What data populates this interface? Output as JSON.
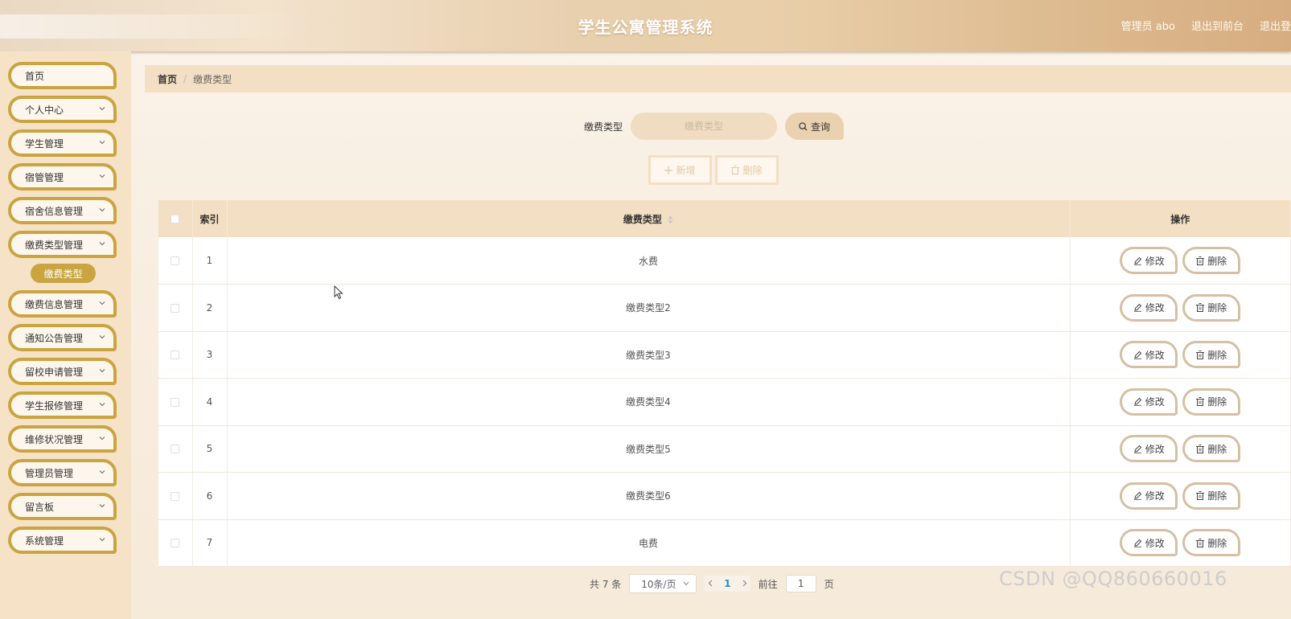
{
  "header": {
    "title": "学生公寓管理系统",
    "user_label": "管理员 abo",
    "to_front_label": "退出到前台",
    "logout_label": "退出登"
  },
  "sidebar": {
    "items": [
      {
        "label": "首页",
        "has_chevron": false
      },
      {
        "label": "个人中心",
        "has_chevron": true
      },
      {
        "label": "学生管理",
        "has_chevron": true
      },
      {
        "label": "宿管管理",
        "has_chevron": true
      },
      {
        "label": "宿舍信息管理",
        "has_chevron": true
      },
      {
        "label": "缴费类型管理",
        "has_chevron": true,
        "expanded": true
      },
      {
        "label": "缴费信息管理",
        "has_chevron": true
      },
      {
        "label": "通知公告管理",
        "has_chevron": true
      },
      {
        "label": "留校申请管理",
        "has_chevron": true
      },
      {
        "label": "学生报修管理",
        "has_chevron": true
      },
      {
        "label": "维修状况管理",
        "has_chevron": true
      },
      {
        "label": "管理员管理",
        "has_chevron": true
      },
      {
        "label": "留言板",
        "has_chevron": true
      },
      {
        "label": "系统管理",
        "has_chevron": true
      }
    ],
    "active_sub_item": "缴费类型"
  },
  "breadcrumb": {
    "home": "首页",
    "separator": "/",
    "current": "缴费类型"
  },
  "search": {
    "label": "缴费类型",
    "placeholder": "缴费类型",
    "query_label": "查询"
  },
  "actions": {
    "add_label": "新增",
    "delete_label": "删除"
  },
  "table": {
    "columns": {
      "index": "索引",
      "type": "缴费类型",
      "ops": "操作"
    },
    "edit_label": "修改",
    "delete_label": "删除",
    "rows": [
      {
        "index": "1",
        "type": "水费"
      },
      {
        "index": "2",
        "type": "缴费类型2"
      },
      {
        "index": "3",
        "type": "缴费类型3"
      },
      {
        "index": "4",
        "type": "缴费类型4"
      },
      {
        "index": "5",
        "type": "缴费类型5"
      },
      {
        "index": "6",
        "type": "缴费类型6"
      },
      {
        "index": "7",
        "type": "电费"
      }
    ]
  },
  "pagination": {
    "total_text": "共 7 条",
    "page_size": "10条/页",
    "current_page": "1",
    "goto_prefix": "前往",
    "goto_value": "1",
    "goto_suffix": "页"
  },
  "watermark": "CSDN @QQ860660016",
  "colors": {
    "accent_gold": "#c9a441",
    "header_tan": "#e8cfae",
    "table_header": "#f3dfc3",
    "page_number": "#1e90d8"
  },
  "icons": [
    "chevron-down-icon",
    "search-icon",
    "plus-icon",
    "trash-icon",
    "edit-icon",
    "sort-icon",
    "chevron-left-icon",
    "chevron-right-icon",
    "mouse-cursor-icon"
  ]
}
